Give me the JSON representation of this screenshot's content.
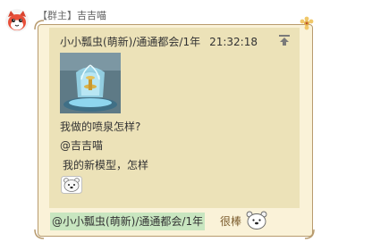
{
  "sender": {
    "role": "【群主】",
    "name": "吉吉喵"
  },
  "quote": {
    "author": "小小瓢虫(萌新)/通通都会/1年",
    "time": "21:32:18",
    "lines": [
      "我做的喷泉怎样?",
      "@吉吉喵",
      "我的新模型，怎样"
    ]
  },
  "reply": {
    "mention": "@小小瓢虫(萌新)/通通都会/1年",
    "text": "很棒"
  },
  "icons": {
    "avatar": "cat-face-avatar",
    "scroll_up": "scroll-up-icon",
    "thumbnail": "fountain-image",
    "emoji": "polar-bear-emoji"
  },
  "colors": {
    "bubble_bg": "#faf2d8",
    "bubble_border": "#b89b6e",
    "quote_bg": "#ece2b8",
    "mention_bg": "#c8e6c0",
    "reply_text": "#7a5a2b"
  }
}
